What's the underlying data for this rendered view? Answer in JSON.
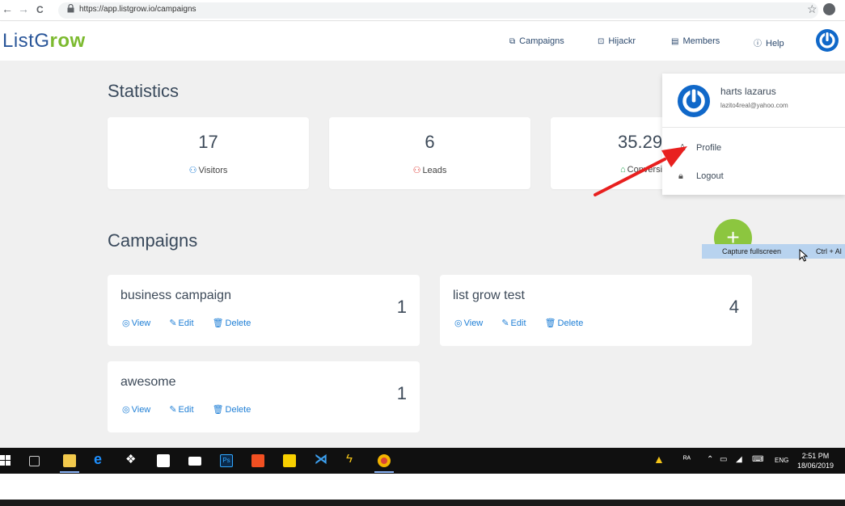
{
  "browser": {
    "back": "←",
    "forward": "→",
    "reload": "C",
    "url": "https://app.listgrow.io/campaigns",
    "bookmark": "☆"
  },
  "header": {
    "logo_part1": "ListG",
    "logo_part2": "row",
    "nav": [
      {
        "icon": "campaigns-icon",
        "glyph": "⧉",
        "label": "Campaigns"
      },
      {
        "icon": "hijackr-icon",
        "glyph": "⊡",
        "label": "Hijackr"
      },
      {
        "icon": "members-icon",
        "glyph": "▤",
        "label": "Members"
      },
      {
        "icon": "help-icon",
        "glyph": "ⓘ",
        "label": "Help"
      }
    ]
  },
  "statistics": {
    "heading": "Statistics",
    "cards": [
      {
        "value": "17",
        "glyph": "⚇",
        "label": "Visitors",
        "color": "#1f7fd6"
      },
      {
        "value": "6",
        "glyph": "⚇",
        "label": "Leads",
        "color": "#e0403a"
      },
      {
        "value": "35.29",
        "glyph": "⌂",
        "label": "Conversion",
        "color": "#2eab5a"
      }
    ]
  },
  "campaigns": {
    "heading": "Campaigns",
    "add_label": "+",
    "actions": {
      "view": "View",
      "edit": "Edit",
      "delete": "Delete"
    },
    "items": [
      {
        "title": "business campaign",
        "count": "1"
      },
      {
        "title": "list grow test",
        "count": "4"
      },
      {
        "title": "awesome",
        "count": "1"
      }
    ]
  },
  "capture": {
    "label": "Capture fullscreen",
    "shortcut": "Ctrl + Al"
  },
  "dropdown": {
    "name": "harts lazarus",
    "email": "lazito4real@yahoo.com",
    "items": [
      {
        "icon": "user-icon",
        "glyph": "♙",
        "label": "Profile"
      },
      {
        "icon": "lock-icon",
        "glyph": "🔒︎",
        "label": "Logout"
      }
    ]
  },
  "taskbar": {
    "lang": "ENG",
    "time": "2:51 PM",
    "date": "18/06/2019"
  },
  "colors": {
    "brand_blue": "#2a5699",
    "brand_green": "#7cba2f",
    "link_blue": "#1f7fd6",
    "avatar_blue": "#1068c9",
    "fab_green": "#8cc63f",
    "arrow_red": "#e8201f"
  }
}
